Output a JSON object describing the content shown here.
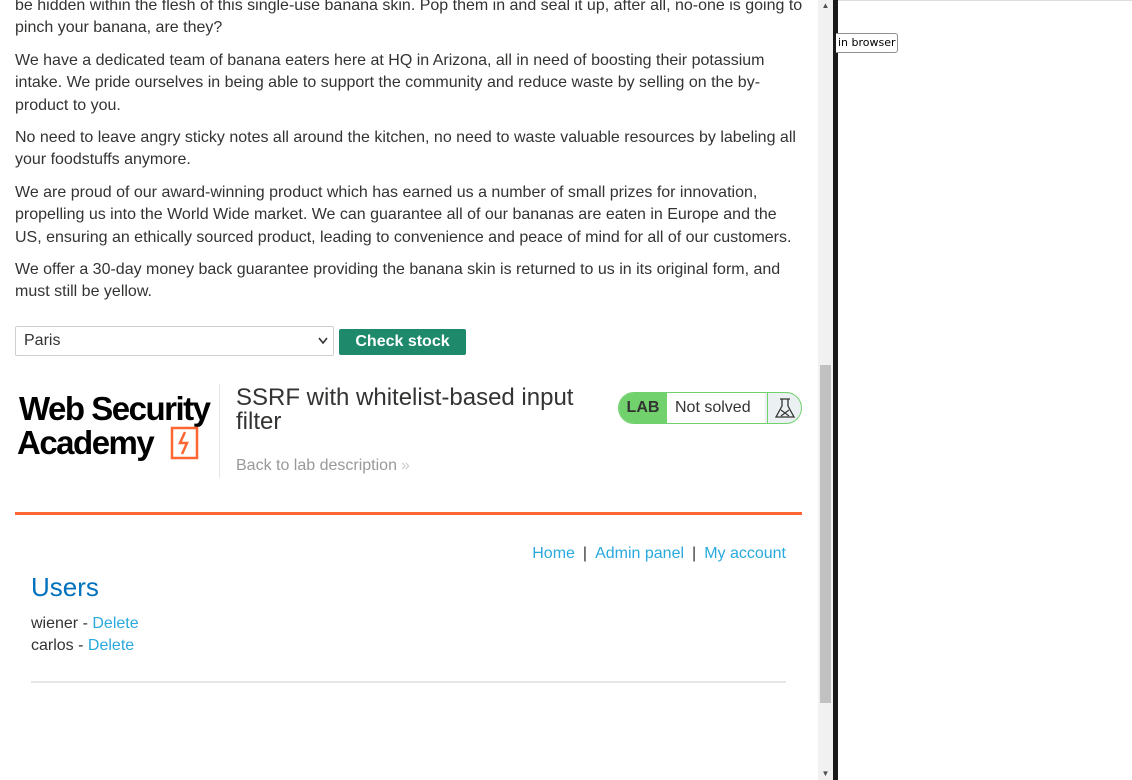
{
  "product": {
    "paragraphs": [
      "be hidden within the flesh of this single-use banana skin. Pop them in and seal it up, after all, no-one is going to pinch your banana, are they?",
      "We have a dedicated team of banana eaters here at HQ in Arizona, all in need of boosting their potassium intake. We pride ourselves in being able to support the community and reduce waste by selling on the by-product to you.",
      "No need to leave angry sticky notes all around the kitchen, no need to waste valuable resources by labeling all your foodstuffs anymore.",
      "We are proud of our award-winning product which has earned us a number of small prizes for innovation, propelling us into the World Wide market. We can guarantee all of our bananas are eaten in Europe and the US, ensuring an ethically sourced product, leading to convenience and peace of mind for all of our customers.",
      "We offer a 30-day money back guarantee providing the banana skin is returned to us in its original form, and must still be yellow."
    ]
  },
  "stock_form": {
    "selected_store": "Paris",
    "check_button": "Check stock"
  },
  "lab_banner": {
    "logo_line1": "Web Security",
    "logo_line2": "Academy",
    "title": "SSRF with whitelist-based input filter",
    "back_link": "Back to lab description",
    "back_chevron": "»",
    "lab_tag": "LAB",
    "status": "Not solved",
    "accent_color": "#ff6633",
    "status_color": "#70d16d"
  },
  "nav": {
    "home": "Home",
    "admin_panel": "Admin panel",
    "my_account": "My account",
    "separator": "|"
  },
  "admin": {
    "heading": "Users",
    "users": [
      {
        "name": "wiener",
        "action": "Delete"
      },
      {
        "name": "carlos",
        "action": "Delete"
      }
    ],
    "dash": " - "
  },
  "right_pane": {
    "button_text": "in browser"
  },
  "icons": {
    "flask": "flask-icon",
    "chevron": "chevron-right-icon",
    "logo_mark": "bolt-icon"
  }
}
